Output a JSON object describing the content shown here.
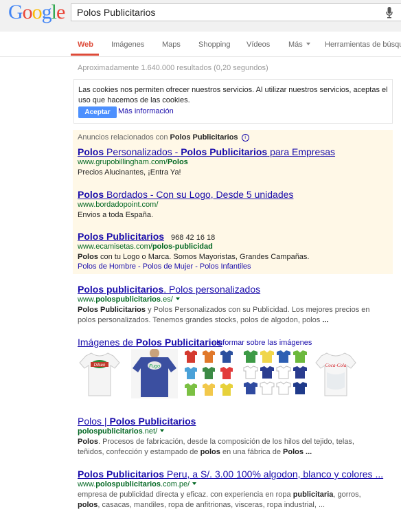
{
  "logo": {
    "letters": [
      "G",
      "o",
      "o",
      "g",
      "l",
      "e"
    ],
    "colors": [
      "#4285f4",
      "#ea4335",
      "#fbbc05",
      "#4285f4",
      "#34a853",
      "#ea4335"
    ]
  },
  "search": {
    "query": "Polos Publicitarios"
  },
  "nav": {
    "items": [
      "Web",
      "Imágenes",
      "Maps",
      "Shopping",
      "Vídeos",
      "Más",
      "Herramientas de búsqu"
    ],
    "active": "Web"
  },
  "stats": "Aproximadamente 1.640.000 resultados (0,20 segundos)",
  "cookie": {
    "text": "Las cookies nos permiten ofrecer nuestros servicios. Al utilizar nuestros servicios, aceptas el uso que hacemos de las cookies.",
    "accept": "Aceptar",
    "more_info": "Más información"
  },
  "ads": {
    "heading_prefix": "Anuncios relacionados con ",
    "heading_query": "Polos Publicitarios",
    "items": [
      {
        "title": {
          "a": "Polos",
          "b": " Personalizados - ",
          "c": "Polos Publicitarios",
          "d": " para Empresas"
        },
        "url": {
          "a": "www.grupobillingham.com/",
          "b": "Polos"
        },
        "snippet": "Precios Alucinantes, ¡Entra Ya!"
      },
      {
        "title": {
          "a": "Polos",
          "b": " Bordados - Con su Logo, Desde 5 unidades"
        },
        "url": {
          "a": "www.bordadopoint.com/"
        },
        "snippet": "Envios a toda España."
      },
      {
        "title": {
          "a": "Polos Publicitarios"
        },
        "phone": "968 42 16 18",
        "url": {
          "a": "www.ecamisetas.com/",
          "b": "polos-publicidad"
        },
        "snippet_bold": "Polos",
        "snippet": " con tu Logo o Marca. Somos Mayoristas, Grandes Campañas.",
        "sitelinks": "Polos de Hombre - Polos de Mujer - Polos Infantiles"
      }
    ]
  },
  "results": [
    {
      "title": {
        "a": "Polos publicitarios",
        "b": ". Polos personalizados"
      },
      "url": {
        "a": "www.",
        "b": "polospublicitarios",
        "c": ".es/"
      },
      "snippet": {
        "l1a": "Polos Publicitarios",
        "l1b": " y Polos Personalizados con su Publicidad. Los mejores precios en",
        "l2": "polos personalizados. Tenemos grandes stocks, polos de algodon, polos ",
        "l2b": "..."
      }
    },
    {
      "title": {
        "a": "Polos | ",
        "b": "Polos Publicitarios"
      },
      "url": {
        "a": "polospublicitarios",
        "b": ".net/"
      },
      "snippet": {
        "l1a": "Polos",
        "l1b": ". Procesos de fabricación, desde la composición de los hilos del tejido, telas,",
        "l2a": "teñidos, confección y estampado de ",
        "l2b": "polos",
        "l2c": " en una fábrica de ",
        "l2d": "Polos ..."
      }
    },
    {
      "title": {
        "a": "Polos Publicitarios",
        "b": " Peru, a S/. 3.00 100% algodon, blanco y colores ..."
      },
      "url": {
        "a": "www.",
        "b": "polospublicitarios",
        "c": ".com.pe/"
      },
      "snippet": {
        "l1a": "empresa de publicidad directa y eficaz. con experiencia en ropa ",
        "l1b": "publicitaria",
        "l1c": ", gorros,",
        "l2a": "polos",
        "l2b": ", casacas, mandiles, ropa de anfitrionas, visceras, ropa industrial, ..."
      }
    }
  ],
  "images": {
    "heading_a": "Imágenes de ",
    "heading_b": "Polos Publicitarios",
    "report": "Informar sobre las imágenes",
    "thumb_text_1": "Dilsen",
    "thumb_text_2": "Fugo",
    "thumb_text_3": "Coca-Cola"
  }
}
